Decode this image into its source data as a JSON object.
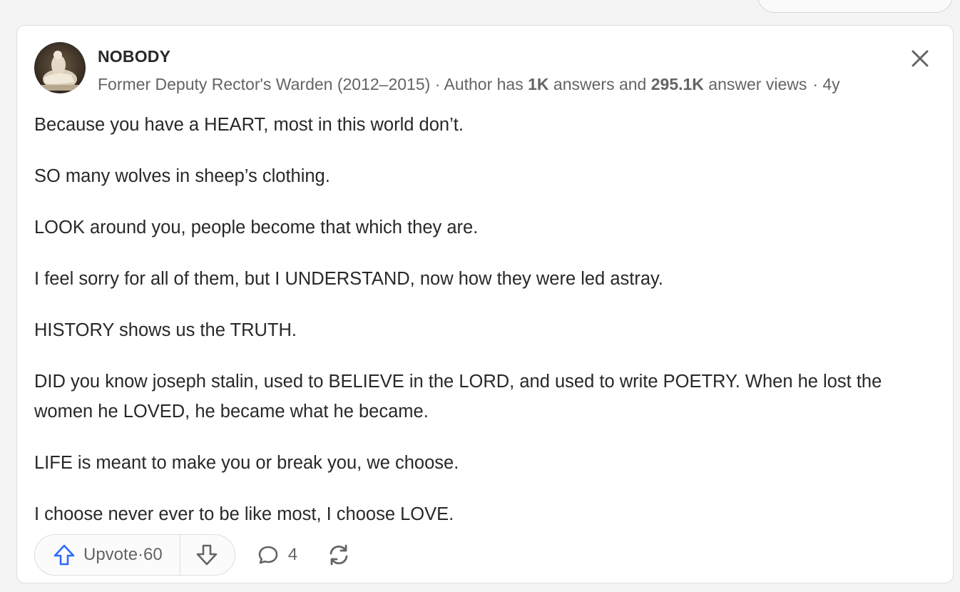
{
  "answer": {
    "author": {
      "name": "NOBODY",
      "credential_role": "Former Deputy Rector's Warden (2012–2015)",
      "credential_sep": " · ",
      "credential_prefix": "Author has ",
      "answers_count": "1K",
      "answers_mid": " answers and ",
      "views_count": "295.1K",
      "credential_suffix": " answer views",
      "time_ago": "· 4y"
    },
    "paragraphs": [
      "Because you have a HEART, most in this world don’t.",
      "SO many wolves in sheep’s clothing.",
      "LOOK around you, people become that which they are.",
      "I feel sorry for all of them, but I UNDERSTAND, now how they were led astray.",
      "HISTORY shows us the TRUTH.",
      "DID you know joseph stalin, used to BELIEVE in the LORD, and used to write POETRY. When he lost the women he LOVED, he became what he became.",
      "LIFE is meant to make you or break you, we choose.",
      "I choose never ever to be like most, I choose LOVE."
    ],
    "actions": {
      "upvote_label": "Upvote",
      "upvote_sep": " · ",
      "upvote_count": "60",
      "comment_count": "4"
    },
    "icons": {
      "close": "close-icon",
      "upvote": "upvote-arrow-icon",
      "downvote": "downvote-arrow-icon",
      "comment": "comment-bubble-icon",
      "share": "reshare-icon",
      "avatar": "avatar-image"
    },
    "colors": {
      "upvote_blue": "#2e69ff",
      "text_primary": "#282829",
      "text_secondary": "#636466"
    }
  }
}
